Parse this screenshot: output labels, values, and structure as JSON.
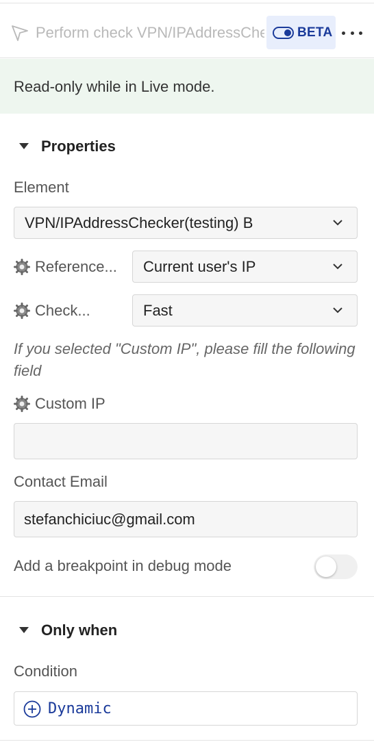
{
  "header": {
    "title": "Perform check VPN/IPAddressChecker",
    "badge_label": "BETA",
    "icon": "send-icon",
    "more_icon": "more-horizontal-icon"
  },
  "notice": {
    "text": "Read-only while in Live mode."
  },
  "properties": {
    "section_title": "Properties",
    "element_label": "Element",
    "element_value": "VPN/IPAddressChecker(testing) B",
    "reference_label": "Reference...",
    "reference_value": "Current user's IP",
    "check_label": "Check...",
    "check_value": "Fast",
    "hint_text": "If you selected \"Custom IP\", please fill the following field",
    "custom_ip_label": "Custom IP",
    "custom_ip_value": "",
    "contact_email_label": "Contact Email",
    "contact_email_value": "stefanchiciuc@gmail.com",
    "breakpoint_label": "Add a breakpoint in debug mode",
    "breakpoint_enabled": false
  },
  "only_when": {
    "section_title": "Only when",
    "condition_label": "Condition",
    "dynamic_label": "Dynamic"
  },
  "colors": {
    "accent": "#1a3a9a",
    "badge_bg": "#e8eefc",
    "notice_bg": "#eef6ef"
  }
}
